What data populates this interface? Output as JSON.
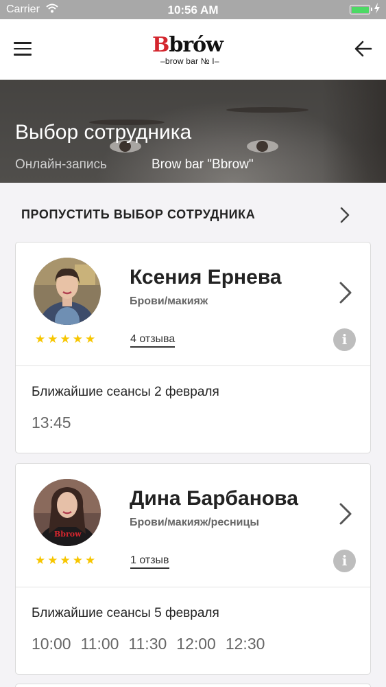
{
  "status_bar": {
    "carrier": "Carrier",
    "time": "10:56 AM",
    "battery_color": "#4cd964"
  },
  "nav": {
    "logo_mark_first": "B",
    "logo_mark_rest": "brów",
    "logo_sub": "–brow bar № I–"
  },
  "hero": {
    "title": "Выбор сотрудника",
    "crumb_1": "Онлайн-запись",
    "crumb_2": "Brow bar \"Bbrow\""
  },
  "skip": {
    "label": "ПРОПУСТИТЬ ВЫБОР СОТРУДНИКА"
  },
  "staff": [
    {
      "name": "Ксения Ернева",
      "role": "Брови/макияж",
      "rating": 5,
      "reviews": "4 отзыва",
      "sessions_label": "Ближайшие сеансы 2 февраля",
      "slots": [
        "13:45"
      ]
    },
    {
      "name": "Дина Барбанова",
      "role": "Брови/макияж/ресницы",
      "rating": 5,
      "reviews": "1 отзыв",
      "sessions_label": "Ближайшие сеансы 5 февраля",
      "slots": [
        "10:00",
        "11:00",
        "11:30",
        "12:00",
        "12:30"
      ]
    }
  ],
  "colors": {
    "accent_red": "#d4262e",
    "star": "#f7c600"
  }
}
